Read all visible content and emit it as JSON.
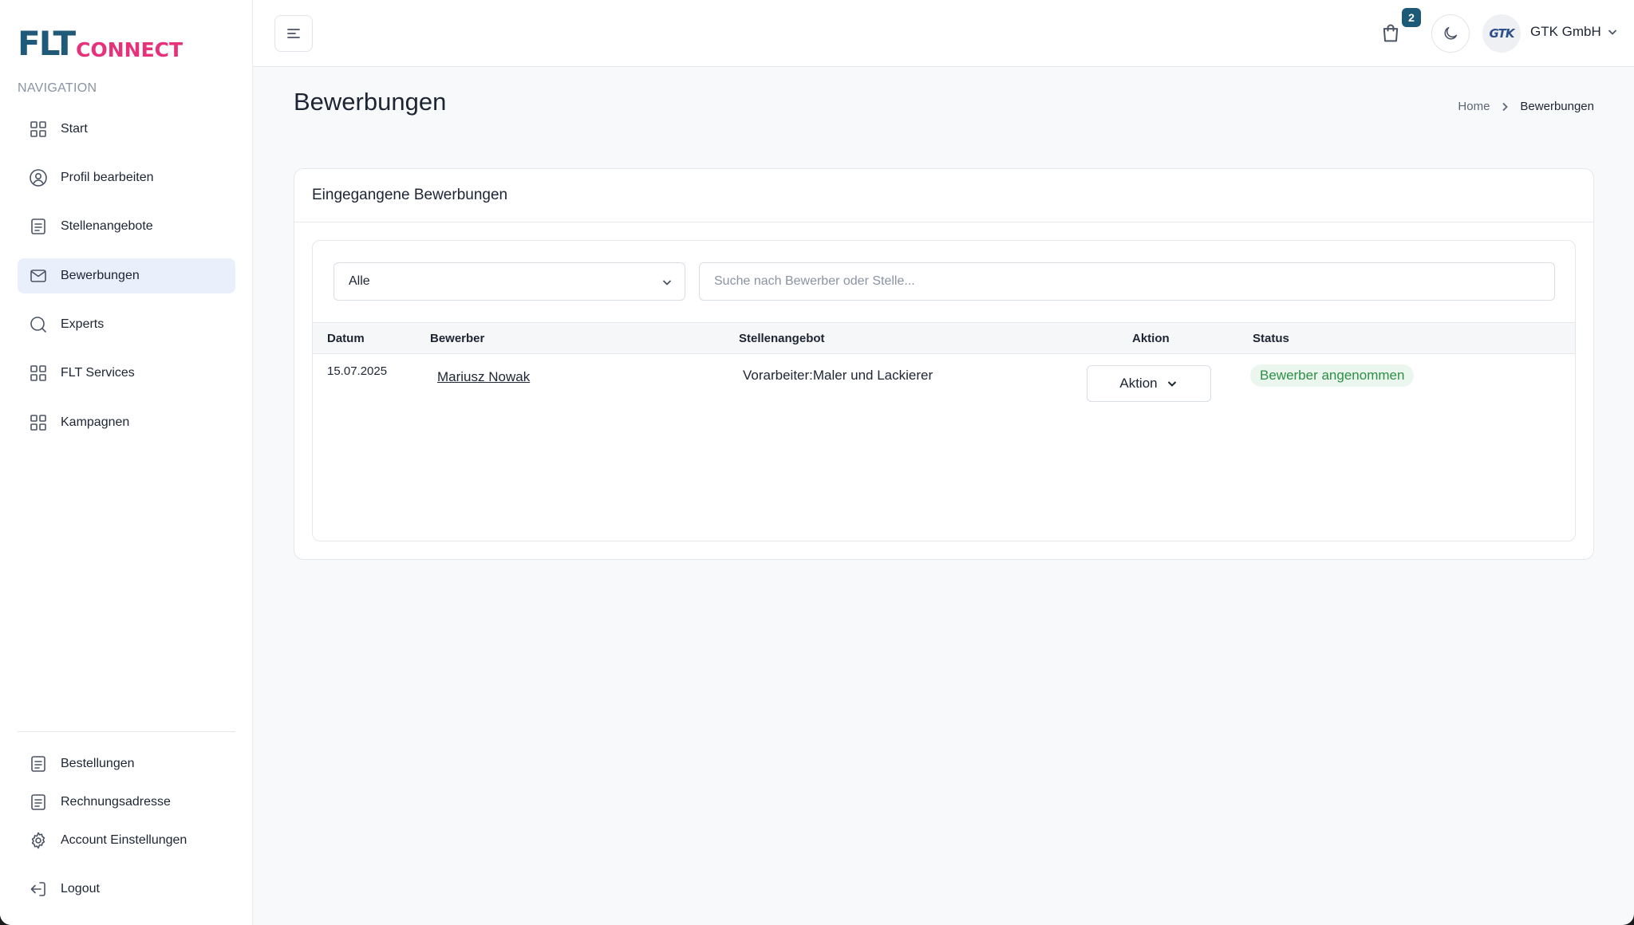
{
  "brand": {
    "logo_main": "FLT",
    "logo_sub": "CONNECT"
  },
  "sidebar": {
    "nav_title": "NAVIGATION",
    "items": [
      {
        "label": "Start",
        "icon": "grid-icon"
      },
      {
        "label": "Profil bearbeiten",
        "icon": "user-circle-icon"
      },
      {
        "label": "Stellenangebote",
        "icon": "document-icon"
      },
      {
        "label": "Bewerbungen",
        "icon": "mail-icon",
        "active": true
      },
      {
        "label": "Experts",
        "icon": "search-icon"
      },
      {
        "label": "FLT Services",
        "icon": "grid-icon"
      },
      {
        "label": "Kampagnen",
        "icon": "grid-icon"
      }
    ],
    "bottom_items": [
      {
        "label": "Bestellungen",
        "icon": "document-icon"
      },
      {
        "label": "Rechnungsadresse",
        "icon": "document-icon"
      },
      {
        "label": "Account Einstellungen",
        "icon": "gear-icon"
      },
      {
        "label": "Logout",
        "icon": "logout-icon"
      }
    ]
  },
  "header": {
    "cart_count": "2",
    "company_name": "GTK GmbH",
    "avatar_text": "GTK"
  },
  "page": {
    "title": "Bewerbungen",
    "breadcrumb": {
      "home": "Home",
      "current": "Bewerbungen"
    }
  },
  "card": {
    "title": "Eingegangene Bewerbungen",
    "filter": {
      "selected": "Alle"
    },
    "search": {
      "placeholder": "Suche nach Bewerber oder Stelle..."
    },
    "table": {
      "columns": [
        "Datum",
        "Bewerber",
        "Stellenangebot",
        "Aktion",
        "Status"
      ],
      "rows": [
        {
          "date": "15.07.2025",
          "applicant": "Mariusz Nowak",
          "job": "Vorarbeiter:Maler und Lackierer",
          "action": "Aktion",
          "status": "Bewerber angenommen"
        }
      ]
    }
  },
  "colors": {
    "brand_blue": "#1f5a7a",
    "brand_pink": "#e6327a",
    "active_nav_bg": "#e9f0fb",
    "status_green": "#2e8f48",
    "status_green_bg": "#eaf6ee"
  }
}
